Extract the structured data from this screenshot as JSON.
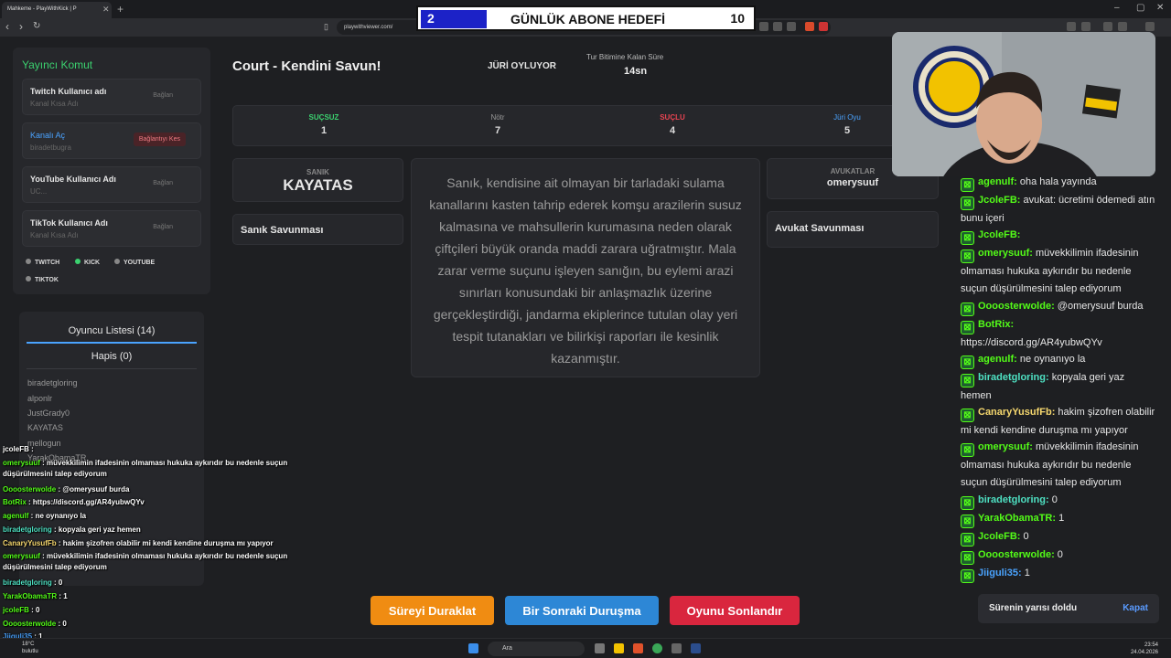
{
  "browser": {
    "tab_title": "Mahkeme - PlayWithKick | P",
    "url": "playwithviewer.com/"
  },
  "goal": {
    "current": "2",
    "title": "GÜNLÜK ABONE HEDEFİ",
    "target": "10",
    "progress_fraction": 0.2
  },
  "broadcaster": {
    "title": "Yayıncı Komut",
    "accounts": [
      {
        "label": "Twitch Kullanıcı adı",
        "sub": "Kanal Kısa Adı",
        "button": "Bağlan"
      },
      {
        "label": "Kanalı Aç",
        "sub": "biradetbugra",
        "button": "Bağlantıyı Kes"
      },
      {
        "label": "YouTube Kullanıcı Adı",
        "sub": "UC...",
        "button": "Bağlan"
      },
      {
        "label": "TikTok Kullanıcı Adı",
        "sub": "Kanal Kısa Adı",
        "button": "Bağlan"
      }
    ],
    "platforms": [
      "TWITCH",
      "KICK",
      "YOUTUBE",
      "TIKTOK"
    ]
  },
  "players": {
    "list_title": "Oyuncu Listesi (14)",
    "jail_title": "Hapis (0)",
    "names": [
      "biradetgloring",
      "alponlr",
      "JustGrady0",
      "KAYATAS",
      "mellogun",
      "YarakObamaTR"
    ]
  },
  "court": {
    "title": "Court - Kendini Savun!",
    "status": "JÜRİ OYLUYOR",
    "timer_label": "Tur Bitimine Kalan Süre",
    "timer_value": "14sn",
    "stats": [
      {
        "label": "SUÇSUZ",
        "value": "1",
        "color": "#3bd16f"
      },
      {
        "label": "Nötr",
        "value": "7",
        "color": "#999999"
      },
      {
        "label": "SUÇLU",
        "value": "4",
        "color": "#e84351"
      },
      {
        "label": "Jüri Oyu",
        "value": "5",
        "color": "#4aa3ff"
      }
    ],
    "accused_label": "SANIK",
    "accused_name": "KAYATAS",
    "accused_defense": "Sanık Savunması",
    "lawyer_label": "AVUKATLAR",
    "lawyer_name": "omerysuuf",
    "lawyer_defense": "Avukat Savunması",
    "accusation": "Sanık, kendisine ait olmayan bir tarladaki sulama kanallarını kasten tahrip ederek komşu arazilerin susuz kalmasına ve mahsullerin kurumasına neden olarak çiftçileri büyük oranda maddi zarara uğratmıştır. Mala zarar verme suçunu işleyen sanığın, bu eylemi arazi sınırları konusundaki bir anlaşmazlık üzerine gerçekleştirdiği, jandarma ekiplerince tutulan olay yeri tespit tutanakları ve bilirkişi raporları ile kesinlik kazanmıştır.",
    "buttons": {
      "pause": "Süreyi Duraklat",
      "next": "Bir Sonraki Duruşma",
      "end": "Oyunu Sonlandır"
    }
  },
  "chat": [
    {
      "user": "agenulf",
      "msg": "oha hala yayında",
      "color": "#53fc18"
    },
    {
      "user": "JcoleFB",
      "msg": "avukat: ücretimi ödemedi atın bunu içeri",
      "color": "#53fc18"
    },
    {
      "user": "JcoleFB",
      "msg": "",
      "color": "#53fc18"
    },
    {
      "user": "omerysuuf",
      "msg": "müvekkilimin ifadesinin olmaması hukuka aykırıdır bu nedenle suçun düşürülmesini talep ediyorum",
      "color": "#53fc18"
    },
    {
      "user": "Oooosterwolde",
      "msg": "@omerysuuf burda",
      "color": "#53fc18"
    },
    {
      "user": "BotRix",
      "msg": "https://discord.gg/AR4yubwQYv",
      "color": "#53fc18"
    },
    {
      "user": "agenulf",
      "msg": "ne oynanıyo la",
      "color": "#53fc18"
    },
    {
      "user": "biradetgloring",
      "msg": "kopyala geri yaz hemen",
      "color": "#4ee0c2"
    },
    {
      "user": "CanaryYusufFb",
      "msg": "hakim şizofren olabilir mi kendi kendine duruşma mı yapıyor",
      "color": "#f5d76e"
    },
    {
      "user": "omerysuuf",
      "msg": "müvekkilimin ifadesinin olmaması hukuka aykırıdır bu nedenle suçun düşürülmesini talep ediyorum",
      "color": "#53fc18"
    },
    {
      "user": "biradetgloring",
      "msg": "0",
      "color": "#4ee0c2"
    },
    {
      "user": "YarakObamaTR",
      "msg": "1",
      "color": "#53fc18"
    },
    {
      "user": "JcoleFB",
      "msg": "0",
      "color": "#53fc18"
    },
    {
      "user": "Oooosterwolde",
      "msg": "0",
      "color": "#53fc18"
    },
    {
      "user": "Jiiguli35",
      "msg": "1",
      "color": "#4aa3ff"
    }
  ],
  "toast": {
    "text": "Sürenin yarısı doldu",
    "action": "Kapat"
  },
  "overlay_chat": [
    {
      "user": "jcoleFB",
      "msg": "",
      "color": "#ffffff"
    },
    {
      "user": "omerysuuf",
      "msg": "müvekkilimin ifadesinin olmaması hukuka aykırıdır bu nedenle suçun düşürülmesini talep ediyorum",
      "color": "#53fc18"
    },
    {
      "user": "Oooosterwolde",
      "msg": "@omerysuuf burda",
      "color": "#53fc18"
    },
    {
      "user": "BotRix",
      "msg": "https://discord.gg/AR4yubwQYv",
      "color": "#53fc18"
    },
    {
      "user": "agenulf",
      "msg": "ne oynanıyo la",
      "color": "#53fc18"
    },
    {
      "user": "biradetgloring",
      "msg": "kopyala geri yaz hemen",
      "color": "#4ee0c2"
    },
    {
      "user": "CanaryYusufFb",
      "msg": "hakim şizofren olabilir mi kendi kendine duruşma mı yapıyor",
      "color": "#f5d76e"
    },
    {
      "user": "omerysuuf",
      "msg": "müvekkilimin ifadesinin olmaması hukuka aykırıdır bu nedenle suçun düşürülmesini talep ediyorum",
      "color": "#53fc18"
    },
    {
      "user": "biradetgloring",
      "msg": "0",
      "color": "#4ee0c2"
    },
    {
      "user": "YarakObamaTR",
      "msg": "1",
      "color": "#53fc18"
    },
    {
      "user": "jcoleFB",
      "msg": "0",
      "color": "#53fc18"
    },
    {
      "user": "Oooosterwolde",
      "msg": "0",
      "color": "#53fc18"
    },
    {
      "user": "Jiiguli35",
      "msg": "1",
      "color": "#4aa3ff"
    }
  ],
  "taskbar": {
    "weather_temp": "18°C",
    "weather_desc": "bulutlu",
    "search": "Ara",
    "time": "23:54",
    "date": "24.04.2026"
  }
}
